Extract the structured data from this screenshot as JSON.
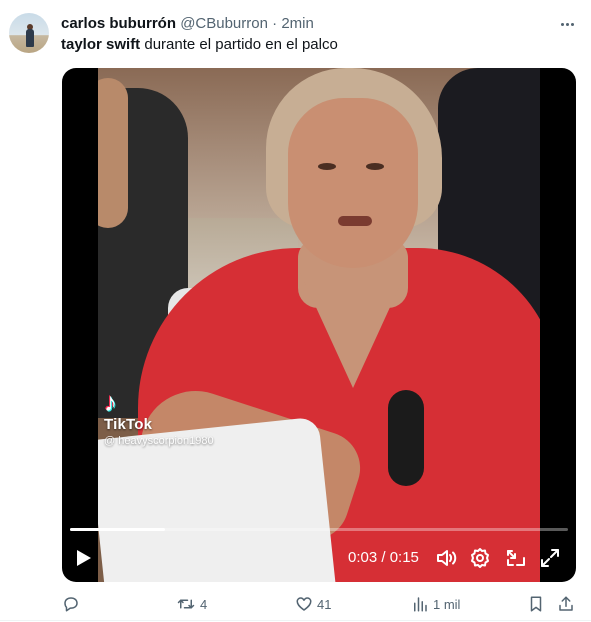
{
  "tweet": {
    "author": {
      "display_name": "carlos buburrón",
      "handle": "@CBuburron",
      "separator": "·",
      "time": "2min"
    },
    "text": {
      "bold": "taylor swift",
      "rest": " durante el partido en el palco"
    },
    "more_icon": "more-dots-icon"
  },
  "video": {
    "watermark": {
      "brand": "TikTok",
      "user": "@ heavyscorpion1980"
    },
    "progress": 0.19,
    "current_time": "0:03",
    "duration": "0:15",
    "time_display": "0:03 / 0:15",
    "icons": [
      "play-icon",
      "volume-icon",
      "settings-icon",
      "pip-icon",
      "fullscreen-icon"
    ]
  },
  "actions": {
    "reply": {
      "icon": "reply-icon",
      "count": ""
    },
    "retweet": {
      "icon": "retweet-icon",
      "count": "4"
    },
    "like": {
      "icon": "heart-icon",
      "count": "41"
    },
    "views": {
      "icon": "views-icon",
      "count": "1 mil"
    },
    "bookmark": {
      "icon": "bookmark-icon"
    },
    "share": {
      "icon": "share-icon"
    }
  },
  "colors": {
    "text_primary": "#0f1419",
    "text_secondary": "#536471"
  }
}
